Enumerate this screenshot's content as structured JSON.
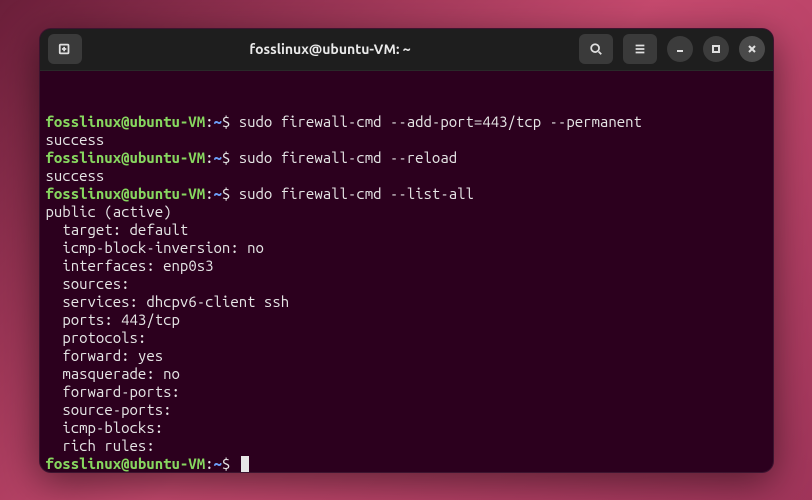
{
  "window": {
    "title": "fosslinux@ubuntu-VM: ~"
  },
  "prompt": {
    "user_host": "fosslinux@ubuntu-VM",
    "colon": ":",
    "path": "~",
    "symbol": "$"
  },
  "session": [
    {
      "type": "cmd",
      "text": "sudo firewall-cmd --add-port=443/tcp --permanent"
    },
    {
      "type": "out",
      "text": "success"
    },
    {
      "type": "cmd",
      "text": "sudo firewall-cmd --reload"
    },
    {
      "type": "out",
      "text": "success"
    },
    {
      "type": "cmd",
      "text": "sudo firewall-cmd --list-all"
    },
    {
      "type": "out",
      "text": "public (active)"
    },
    {
      "type": "out",
      "text": "  target: default"
    },
    {
      "type": "out",
      "text": "  icmp-block-inversion: no"
    },
    {
      "type": "out",
      "text": "  interfaces: enp0s3"
    },
    {
      "type": "out",
      "text": "  sources:"
    },
    {
      "type": "out",
      "text": "  services: dhcpv6-client ssh"
    },
    {
      "type": "out",
      "text": "  ports: 443/tcp"
    },
    {
      "type": "out",
      "text": "  protocols:"
    },
    {
      "type": "out",
      "text": "  forward: yes"
    },
    {
      "type": "out",
      "text": "  masquerade: no"
    },
    {
      "type": "out",
      "text": "  forward-ports:"
    },
    {
      "type": "out",
      "text": "  source-ports:"
    },
    {
      "type": "out",
      "text": "  icmp-blocks:"
    },
    {
      "type": "out",
      "text": "  rich rules:"
    },
    {
      "type": "prompt-cursor"
    }
  ]
}
